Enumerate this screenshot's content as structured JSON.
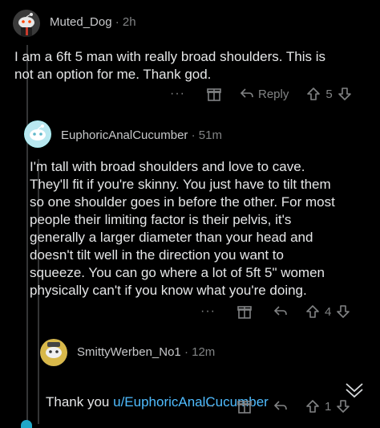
{
  "comments": [
    {
      "username": "Muted_Dog",
      "age": "2h",
      "body": "I am a 6ft 5 man with really broad shoulders. This is\nnot an option for me. Thank god.",
      "actions": {
        "more": "···",
        "reply": "Reply",
        "votes": "5"
      }
    },
    {
      "username": "EuphoricAnalCucumber",
      "age": "51m",
      "body": "I'm tall with broad shoulders and love to cave.\nThey'll fit if you're skinny. You just have to tilt them\nso one shoulder goes in before the other. For most\npeople their limiting factor is their pelvis, it's\ngenerally a larger diameter than your head and\ndoesn't tilt well in the direction you want to\nsqueeze. You can go where a lot of 5ft 5\" women\nphysically can't if you know what you're doing.",
      "actions": {
        "more": "···",
        "votes": "4"
      }
    },
    {
      "username": "SmittyWerben_No1",
      "age": "12m",
      "body_prefix": "Thank you ",
      "body_link": "u/EuphoricAnalCucumber",
      "actions": {
        "more": "···",
        "votes": "1"
      }
    }
  ],
  "separator": "·",
  "colors": {
    "background": "#000000",
    "link": "#4fbcff",
    "muted": "#818384"
  },
  "icons": [
    "award-icon",
    "reply-icon",
    "upvote-icon",
    "downvote-icon",
    "collapse-chevrons-icon"
  ]
}
